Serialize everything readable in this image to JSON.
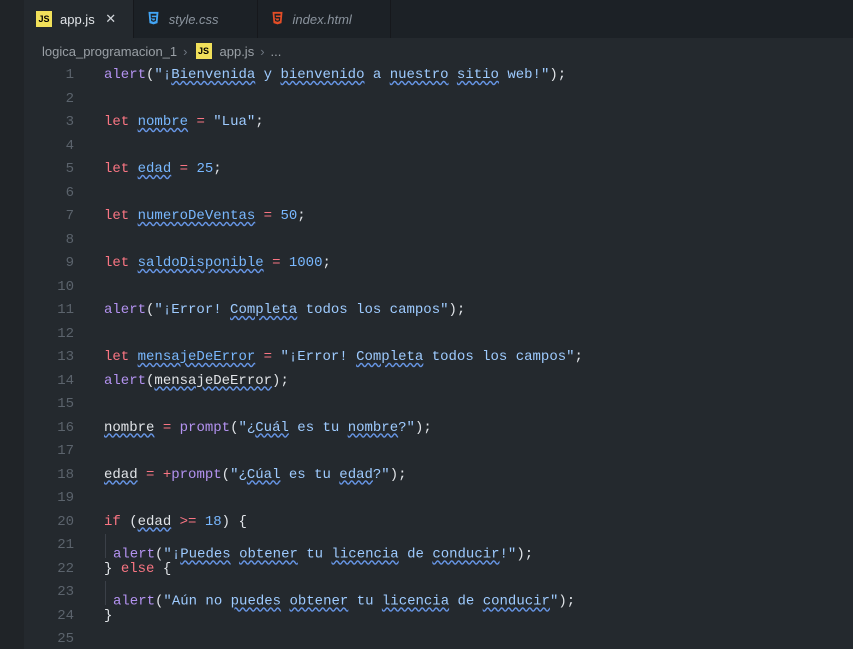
{
  "tabs": [
    {
      "label": "app.js",
      "icon": "js"
    },
    {
      "label": "style.css",
      "icon": "css"
    },
    {
      "label": "index.html",
      "icon": "html"
    }
  ],
  "breadcrumb": {
    "folder": "logica_programacion_1",
    "file": "app.js",
    "ellipsis": "..."
  },
  "line_numbers": [
    "1",
    "2",
    "3",
    "4",
    "5",
    "6",
    "7",
    "8",
    "9",
    "10",
    "11",
    "12",
    "13",
    "14",
    "15",
    "16",
    "17",
    "18",
    "19",
    "20",
    "21",
    "22",
    "23",
    "24",
    "25"
  ],
  "code": {
    "l1_fn": "alert",
    "l1_str": "\"¡Bienvenida y bienvenido a nuestro sitio web!\"",
    "l1_w1": "Bienvenida",
    "l1_w2": "bienvenido",
    "l1_w3": "nuestro",
    "l1_w4": "sitio",
    "let": "let",
    "l3_var": "nombre",
    "l3_val": "\"Lua\"",
    "l5_var": "edad",
    "l5_val": "25",
    "l7_var": "numeroDeVentas",
    "l7_val": "50",
    "l9_var": "saldoDisponible",
    "l9_val": "1000",
    "l11_fn": "alert",
    "l11_pre": "\"¡Error! ",
    "l11_w": "Completa",
    "l11_post": " todos los campos\"",
    "l13_var": "mensajeDeError",
    "l13_pre": "\"¡Error! ",
    "l13_w": "Completa",
    "l13_post": " todos los campos\"",
    "l14_fn": "alert",
    "l14_arg": "mensajeDeError",
    "l16_var": "nombre",
    "l16_fn": "prompt",
    "l16_pre": "\"¿",
    "l16_w1": "Cuál",
    "l16_mid": " es tu ",
    "l16_w2": "nombre",
    "l16_post": "?\"",
    "l18_var": "edad",
    "l18_fn": "prompt",
    "l18_pre": "\"¿",
    "l18_w1": "Cúal",
    "l18_mid": " es tu ",
    "l18_w2": "edad",
    "l18_post": "?\"",
    "if": "if",
    "else": "else",
    "l20_var": "edad",
    "l20_num": "18",
    "l21_fn": "alert",
    "l21_pre": "\"¡",
    "l21_w1": "Puedes",
    "l21_sp1": " ",
    "l21_w2": "obtener",
    "l21_mid": " tu ",
    "l21_w3": "licencia",
    "l21_mid2": " de ",
    "l21_w4": "conducir",
    "l21_post": "!\"",
    "l23_fn": "alert",
    "l23_pre": "\"Aún no ",
    "l23_w1": "puedes",
    "l23_sp1": " ",
    "l23_w2": "obtener",
    "l23_mid": " tu ",
    "l23_w3": "licencia",
    "l23_mid2": " de ",
    "l23_w4": "conducir",
    "l23_post": "\""
  }
}
